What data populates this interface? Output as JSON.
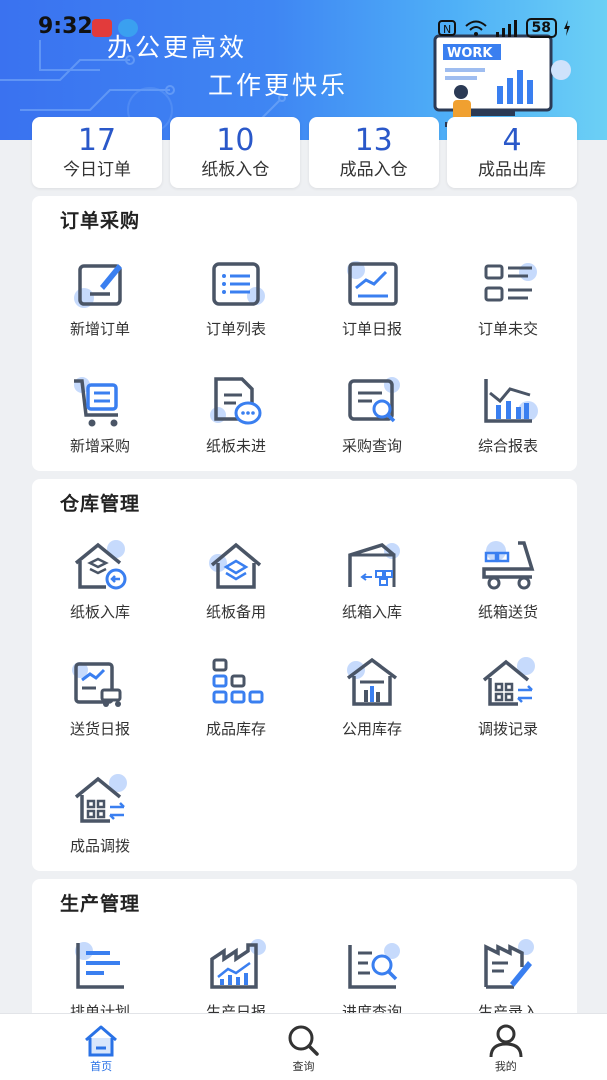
{
  "status_bar": {
    "time": "9:32",
    "battery": "58"
  },
  "banner": {
    "slogan_line1": "办公更高效",
    "slogan_line2": "工作更快乐",
    "illustration_text": "WORK"
  },
  "stats": [
    {
      "value": "17",
      "label": "今日订单"
    },
    {
      "value": "10",
      "label": "纸板入仓"
    },
    {
      "value": "13",
      "label": "成品入仓"
    },
    {
      "value": "4",
      "label": "成品出库"
    }
  ],
  "sections": [
    {
      "title": "订单采购",
      "items": [
        {
          "label": "新增订单",
          "icon": "edit-document-icon"
        },
        {
          "label": "订单列表",
          "icon": "list-icon"
        },
        {
          "label": "订单日报",
          "icon": "trend-report-icon"
        },
        {
          "label": "订单未交",
          "icon": "pending-list-icon"
        },
        {
          "label": "新增采购",
          "icon": "shopping-cart-icon"
        },
        {
          "label": "纸板未进",
          "icon": "document-chat-icon"
        },
        {
          "label": "采购查询",
          "icon": "document-search-icon"
        },
        {
          "label": "综合报表",
          "icon": "bar-chart-icon"
        }
      ]
    },
    {
      "title": "仓库管理",
      "items": [
        {
          "label": "纸板入库",
          "icon": "warehouse-in-icon"
        },
        {
          "label": "纸板备用",
          "icon": "warehouse-layers-icon"
        },
        {
          "label": "纸箱入库",
          "icon": "box-warehouse-icon"
        },
        {
          "label": "纸箱送货",
          "icon": "delivery-truck-icon"
        },
        {
          "label": "送货日报",
          "icon": "delivery-report-icon"
        },
        {
          "label": "成品库存",
          "icon": "stacked-boxes-icon"
        },
        {
          "label": "公用库存",
          "icon": "warehouse-chart-icon"
        },
        {
          "label": "调拨记录",
          "icon": "transfer-house-icon"
        },
        {
          "label": "成品调拨",
          "icon": "transfer-house-icon"
        }
      ]
    },
    {
      "title": "生产管理",
      "items": [
        {
          "label": "排单计划",
          "icon": "schedule-bars-icon"
        },
        {
          "label": "生产日报",
          "icon": "factory-chart-icon"
        },
        {
          "label": "进度查询",
          "icon": "progress-search-icon"
        },
        {
          "label": "生产录入",
          "icon": "factory-edit-icon"
        }
      ]
    }
  ],
  "tabbar": [
    {
      "label": "首页",
      "icon": "home-icon",
      "active": true
    },
    {
      "label": "查询",
      "icon": "search-icon",
      "active": false
    },
    {
      "label": "我的",
      "icon": "user-icon",
      "active": false
    }
  ],
  "colors": {
    "primary": "#2a72e6",
    "icon_stroke": "#4a5566",
    "icon_accent": "#3a7ff0",
    "icon_blob": "#bcd3fb"
  }
}
